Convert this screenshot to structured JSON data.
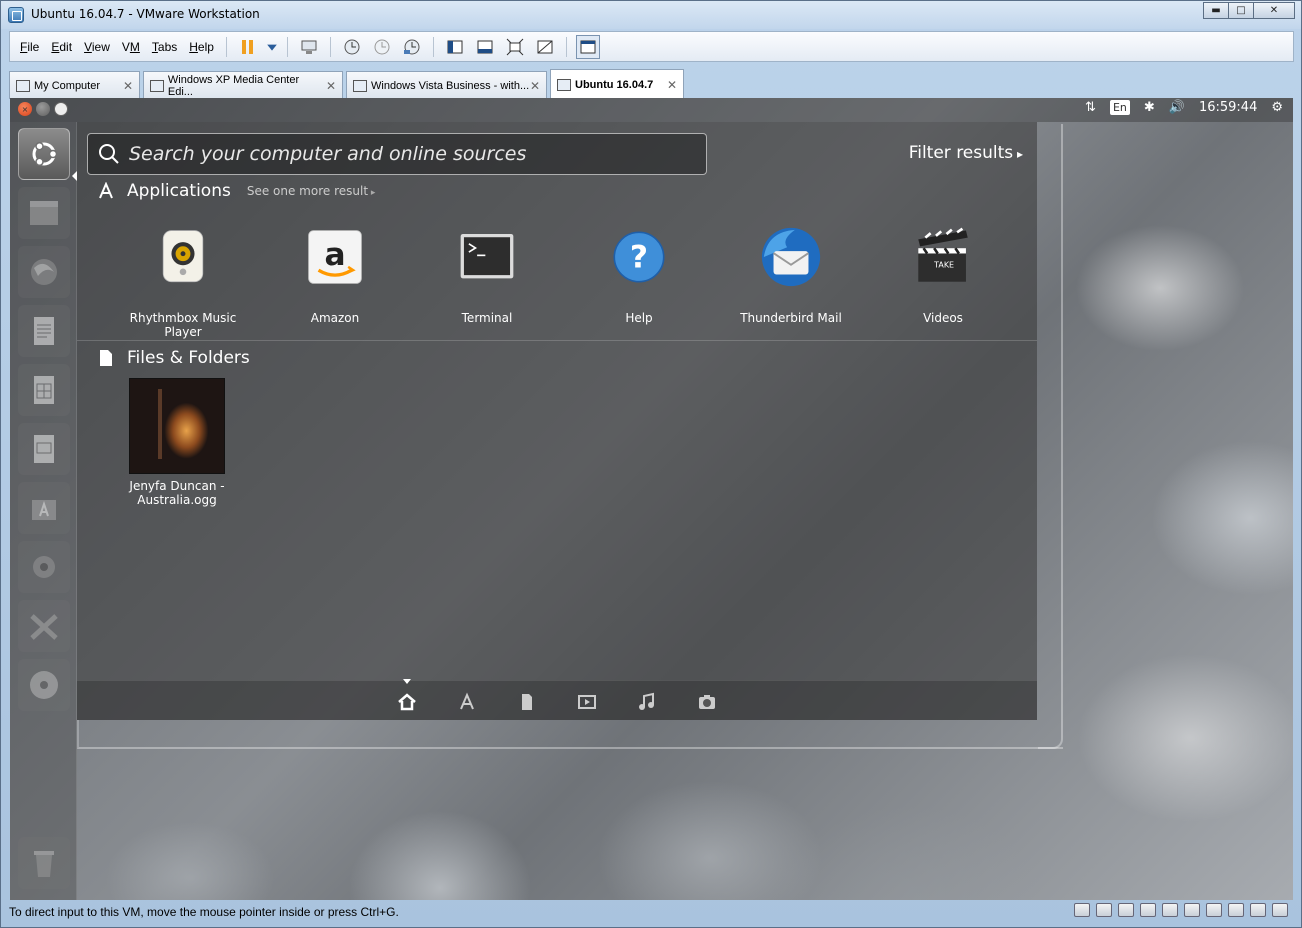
{
  "window": {
    "title": "Ubuntu 16.04.7 - VMware Workstation"
  },
  "menu": [
    {
      "label": "File",
      "key": "F"
    },
    {
      "label": "Edit",
      "key": "E"
    },
    {
      "label": "View",
      "key": "V"
    },
    {
      "label": "VM",
      "key": "M"
    },
    {
      "label": "Tabs",
      "key": "T"
    },
    {
      "label": "Help",
      "key": "H"
    }
  ],
  "tabs": [
    {
      "label": "My Computer"
    },
    {
      "label": "Windows XP Media Center Edi..."
    },
    {
      "label": "Windows Vista Business - with..."
    },
    {
      "label": "Ubuntu 16.04.7"
    }
  ],
  "topbar": {
    "lang": "En",
    "time": "16:59:44"
  },
  "dash": {
    "search_placeholder": "Search your computer and online sources",
    "filter_label": "Filter results",
    "applications_heading": "Applications",
    "see_more": "See one more result",
    "apps": [
      {
        "label": "Rhythmbox Music Player",
        "icon": "rhythmbox-icon"
      },
      {
        "label": "Amazon",
        "icon": "amazon-icon"
      },
      {
        "label": "Terminal",
        "icon": "terminal-icon"
      },
      {
        "label": "Help",
        "icon": "help-icon"
      },
      {
        "label": "Thunderbird Mail",
        "icon": "thunderbird-icon"
      },
      {
        "label": "Videos",
        "icon": "videos-icon"
      }
    ],
    "files_heading": "Files & Folders",
    "files": [
      {
        "label": "Jenyfa Duncan - Australia.ogg"
      }
    ]
  },
  "status": {
    "text": "To direct input to this VM, move the mouse pointer inside or press Ctrl+G."
  },
  "colors": {
    "ubuntu_orange": "#e95420",
    "dash_bg": "#373737"
  }
}
